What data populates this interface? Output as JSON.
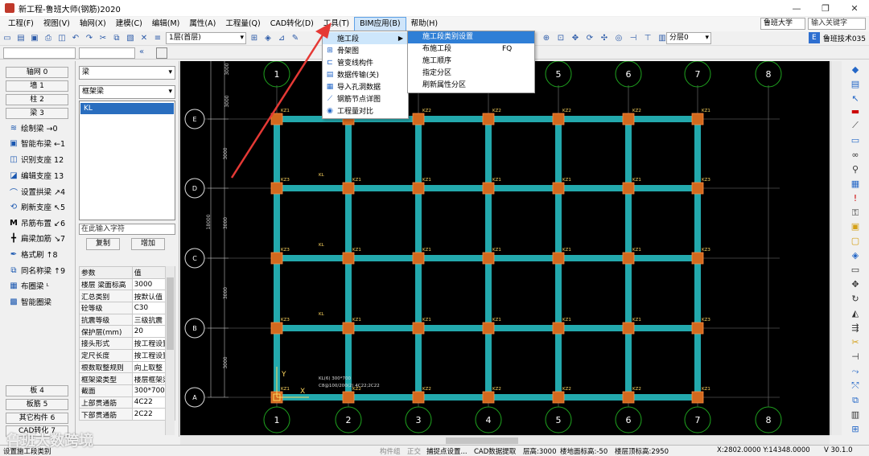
{
  "window": {
    "title": "新工程-鲁班大师(钢筋)2020",
    "controls": [
      "—",
      "❐",
      "✕"
    ]
  },
  "menu": {
    "items": [
      "工程(F)",
      "视图(V)",
      "轴网(X)",
      "建模(C)",
      "编辑(M)",
      "属性(A)",
      "工程量(Q)",
      "CAD转化(D)",
      "工具(T)",
      "BIM应用(B)",
      "帮助(H)"
    ],
    "active_index": 9,
    "dropdown": [
      {
        "label": "施工段",
        "icon": "construction-stage-icon",
        "has_sub": true
      },
      {
        "label": "骨架图",
        "icon": "skeleton-icon"
      },
      {
        "label": "管变线构件",
        "icon": "pipe-convert-icon"
      },
      {
        "label": "数据传输(关)",
        "icon": "data-transfer-icon"
      },
      {
        "label": "导入孔洞数据",
        "icon": "import-hole-icon"
      },
      {
        "label": "钢筋节点详图",
        "icon": "rebar-node-icon"
      },
      {
        "label": "工程量对比",
        "icon": "quantity-compare-icon"
      }
    ],
    "submenu": [
      {
        "label": "施工段类别设置",
        "shortcut": ""
      },
      {
        "label": "布施工段",
        "shortcut": "FQ"
      },
      {
        "label": "施工顺序",
        "shortcut": ""
      },
      {
        "label": "指定分区",
        "shortcut": ""
      },
      {
        "label": "刷新属性分区",
        "shortcut": ""
      }
    ]
  },
  "search": {
    "scope": "鲁班大学",
    "placeholder": "输入关键字"
  },
  "toolbar": {
    "floor": "1层(首层)",
    "layer": "分层0",
    "support": "鲁班技术035"
  },
  "left_panel": {
    "categories_top": [
      "轴网 0",
      "墙 1",
      "柱 2",
      "梁 3"
    ],
    "tools": [
      {
        "label": "绘制梁 →0",
        "icon": "draw-beam-icon"
      },
      {
        "label": "智能布梁 ←1",
        "icon": "smart-beam-icon"
      },
      {
        "label": "识别支座 12",
        "icon": "recognize-support-icon"
      },
      {
        "label": "编辑支座 13",
        "icon": "edit-support-icon"
      },
      {
        "label": "设置拱梁 ↗4",
        "icon": "arch-beam-icon"
      },
      {
        "label": "刷新支座 ↖5",
        "icon": "refresh-support-icon"
      },
      {
        "label": "吊筋布置 ↙6",
        "icon": "hanger-rebar-icon"
      },
      {
        "label": "扁梁加筋 ↘7",
        "icon": "flat-beam-rebar-icon"
      },
      {
        "label": "格式刷 ↑8",
        "icon": "format-brush-icon"
      },
      {
        "label": "同名称梁 ↑9",
        "icon": "same-name-beam-icon"
      },
      {
        "label": "布圈梁 ᴸ",
        "icon": "ring-beam-icon"
      },
      {
        "label": "智能圈梁",
        "icon": "smart-ring-beam-icon"
      }
    ],
    "categories_bottom": [
      "板 4",
      "板筋 5",
      "其它构件 6",
      "CAD转化 7"
    ]
  },
  "mid_panel": {
    "type_select": "梁",
    "subtype_select": "框架梁",
    "list_selected": "KL",
    "filter_placeholder": "在此输入字符",
    "copy_button": "复制",
    "add_button": "增加",
    "props_header": [
      "参数",
      "值"
    ],
    "props": [
      [
        "楼层 梁面标高",
        "3000"
      ],
      [
        "汇总类别",
        "按默认值"
      ],
      [
        "砼等级",
        "C30"
      ],
      [
        "抗震等级",
        "三级抗震"
      ],
      [
        "保护层(mm)",
        "20"
      ],
      [
        "接头形式",
        "按工程设置"
      ],
      [
        "定尺长度",
        "按工程设置"
      ],
      [
        "根数取整规则",
        "向上取整"
      ],
      [
        "框架梁类型",
        "楼层框架梁"
      ],
      [
        "截面",
        "300*700"
      ],
      [
        "上部贯通筋",
        "4C22"
      ],
      [
        "下部贯通筋",
        "2C22"
      ]
    ]
  },
  "canvas": {
    "axis_top": [
      "1",
      "2",
      "3",
      "4",
      "5",
      "6",
      "7",
      "8"
    ],
    "axis_bottom": [
      "1",
      "2",
      "3",
      "4",
      "5",
      "6",
      "7",
      "8"
    ],
    "axis_left": [
      "E",
      "D",
      "C",
      "B",
      "A"
    ],
    "dims_left": [
      "3000",
      "3000",
      "3000",
      "3000"
    ],
    "dim_total": "18000",
    "annotation": [
      "KL(6) 300*700",
      "C8@100/200(2) 4C22;2C22"
    ],
    "ucs_y": "Y",
    "ucs_x": "X",
    "col_label": "KZ1",
    "col_label2": "KZ2",
    "col_label3": "KZ3",
    "kl_label": "KL"
  },
  "status": {
    "hint": "设置施工段类别",
    "center": "鲁班大数跨境",
    "component": "构件组",
    "ortho": "正交",
    "snap": "捕捉点设置...",
    "cad_extract": "CAD数据提取",
    "floor_height": "层高:3000",
    "floor_bottom": "楼地面标高:-50",
    "floor_top": "楼层顶标高:2950",
    "coords": "X:2802.0000 Y:14348.0000",
    "version": "V 30.1.0"
  },
  "colors": {
    "beam": "#23a9ad",
    "column": "#d2691e",
    "axis": "#1fa31f",
    "menu_highlight": "#2f7fd6",
    "arrow": "#e53935"
  }
}
